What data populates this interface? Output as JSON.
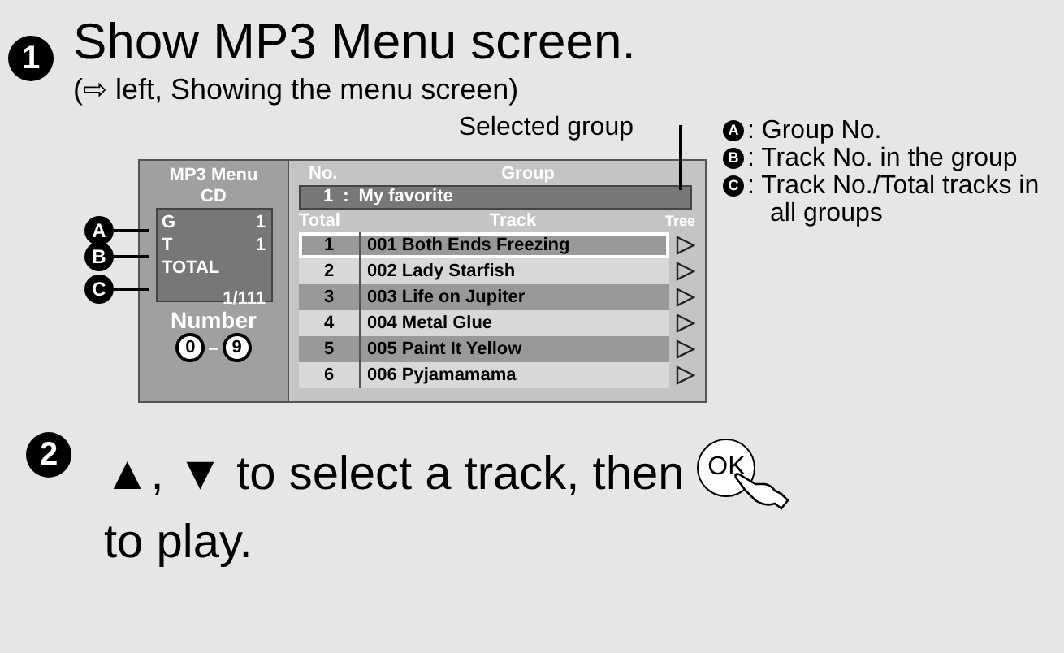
{
  "step1": {
    "number": "1",
    "title": "Show MP3 Menu screen.",
    "note": "(⇨ left, Showing the menu screen)",
    "callout": "Selected group",
    "menu": {
      "title": "MP3 Menu",
      "media": "CD",
      "rows": [
        {
          "marker": "A",
          "label": "G",
          "value": "1"
        },
        {
          "marker": "B",
          "label": "T",
          "value": "1"
        },
        {
          "marker": "C",
          "label": "TOTAL",
          "value": "1/111"
        }
      ],
      "number_label": "Number",
      "keys": [
        "0",
        "9"
      ],
      "key_separator": "–",
      "group_header": {
        "no": "No.",
        "group": "Group"
      },
      "group": {
        "no": "1",
        "separator": ":",
        "name": "My favorite"
      },
      "track_header": {
        "total": "Total",
        "track": "Track",
        "tree": "Tree"
      },
      "tracks": [
        {
          "no": "1",
          "name": "001 Both Ends Freezing",
          "selected": true
        },
        {
          "no": "2",
          "name": "002 Lady Starfish",
          "selected": false
        },
        {
          "no": "3",
          "name": "003 Life on Jupiter",
          "selected": false
        },
        {
          "no": "4",
          "name": "004 Metal Glue",
          "selected": false
        },
        {
          "no": "5",
          "name": "005 Paint It Yellow",
          "selected": false
        },
        {
          "no": "6",
          "name": "006 Pyjamamama",
          "selected": false
        }
      ]
    },
    "legend": [
      {
        "marker": "A",
        "text": ": Group No."
      },
      {
        "marker": "B",
        "text": ": Track No. in the group"
      },
      {
        "marker": "C",
        "text": ": Track No./Total tracks in all groups"
      }
    ]
  },
  "step2": {
    "number": "2",
    "text_before": "▲, ▼ to select a track, then",
    "button": "OK",
    "text_after": "to play."
  }
}
